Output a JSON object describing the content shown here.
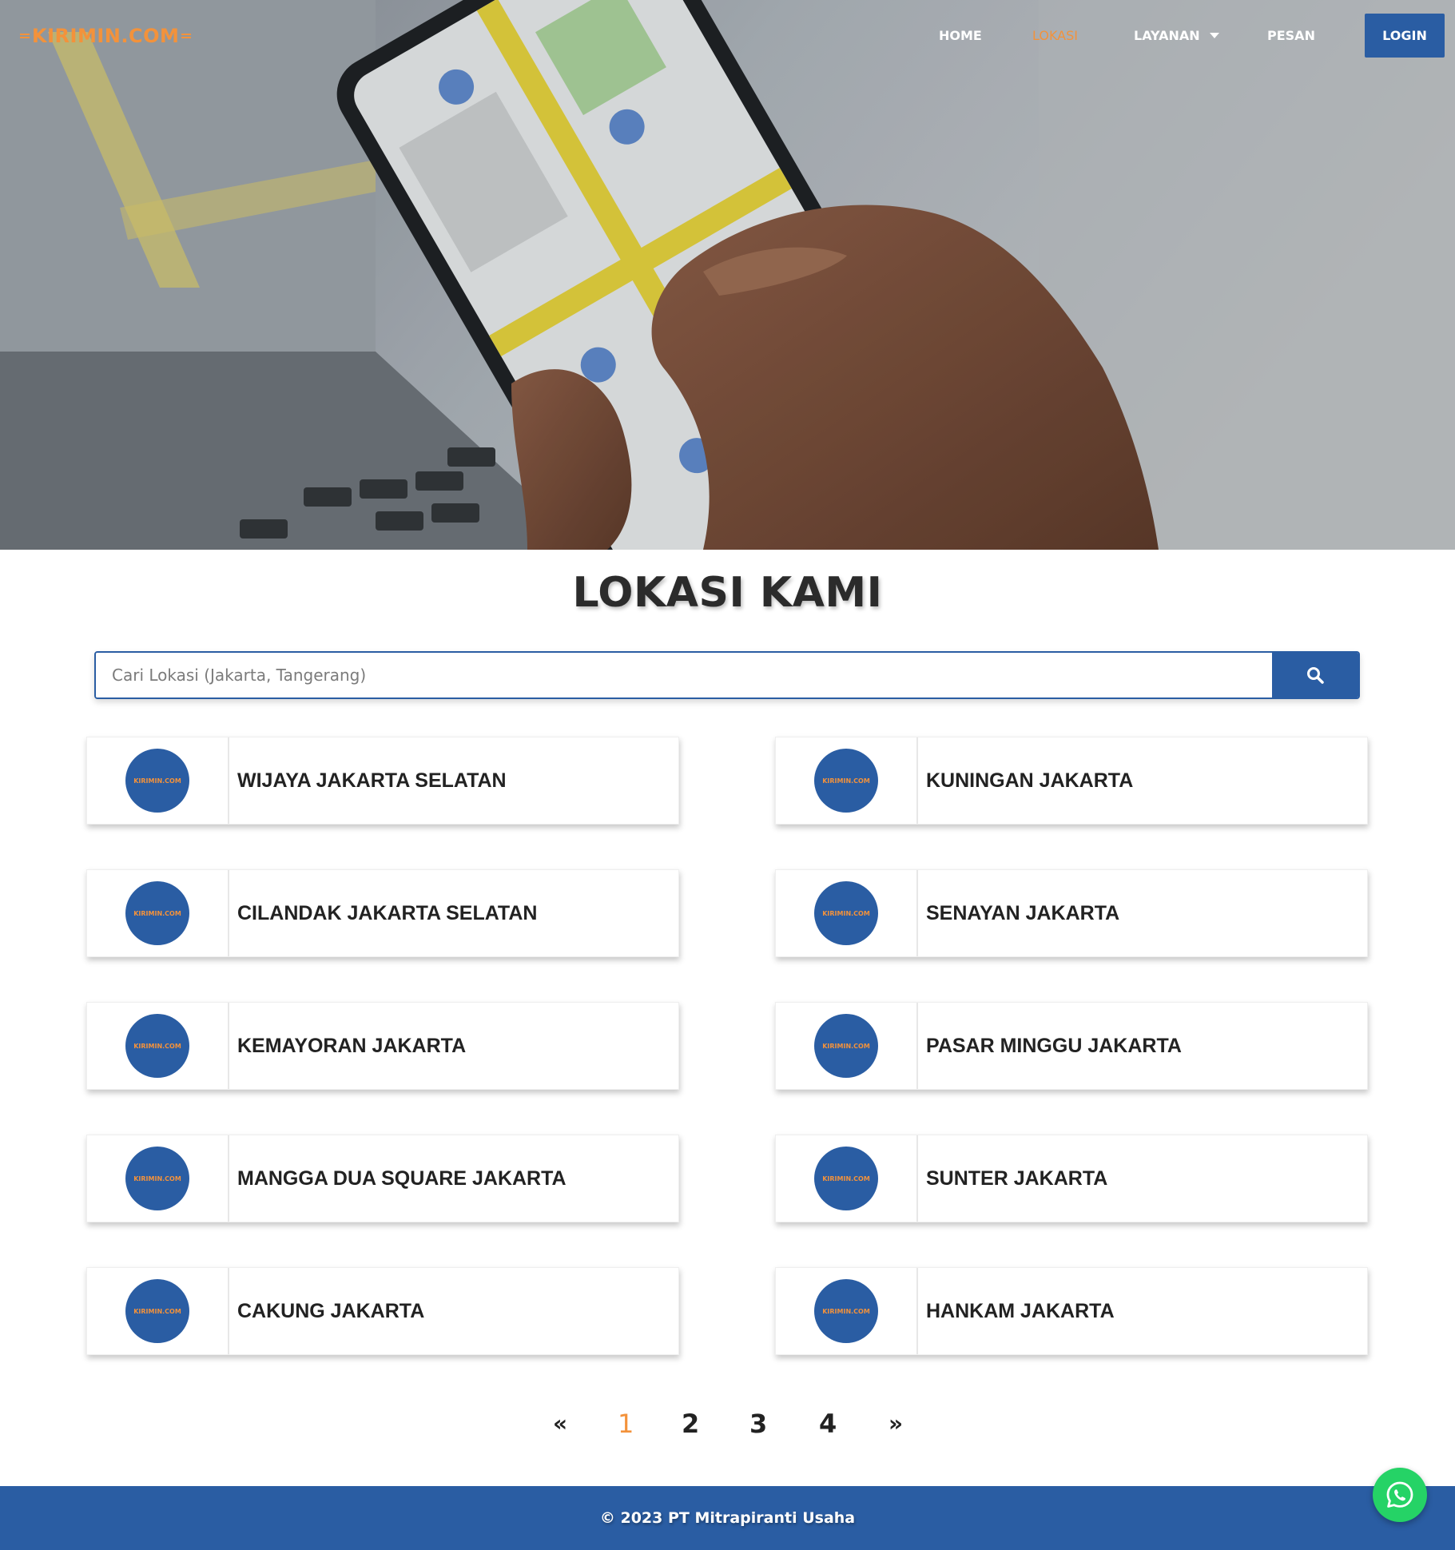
{
  "brand": {
    "logo_text": "KIRIMIN.COM",
    "accent_color": "#f3923b",
    "primary_color": "#2a5da3"
  },
  "nav": {
    "items": [
      {
        "label": "HOME"
      },
      {
        "label": "LOKASI",
        "active": true
      },
      {
        "label": "LAYANAN",
        "has_dropdown": true
      },
      {
        "label": "PESAN"
      }
    ],
    "login_label": "LOGIN"
  },
  "page": {
    "title": "LOKASI KAMI"
  },
  "search": {
    "placeholder": "Cari Lokasi (Jakarta, Tangerang)",
    "value": "",
    "button_icon": "search-icon"
  },
  "locations": [
    {
      "name": "WIJAYA JAKARTA SELATAN",
      "badge": "KIRIMIN.COM"
    },
    {
      "name": "KUNINGAN JAKARTA",
      "badge": "KIRIMIN.COM"
    },
    {
      "name": "CILANDAK JAKARTA SELATAN",
      "badge": "KIRIMIN.COM"
    },
    {
      "name": "SENAYAN JAKARTA",
      "badge": "KIRIMIN.COM"
    },
    {
      "name": "KEMAYORAN JAKARTA",
      "badge": "KIRIMIN.COM"
    },
    {
      "name": "PASAR MINGGU JAKARTA",
      "badge": "KIRIMIN.COM"
    },
    {
      "name": "MANGGA DUA SQUARE JAKARTA",
      "badge": "KIRIMIN.COM"
    },
    {
      "name": "SUNTER JAKARTA",
      "badge": "KIRIMIN.COM"
    },
    {
      "name": "CAKUNG JAKARTA",
      "badge": "KIRIMIN.COM"
    },
    {
      "name": "HANKAM JAKARTA",
      "badge": "KIRIMIN.COM"
    }
  ],
  "pagination": {
    "prev": "«",
    "pages": [
      "1",
      "2",
      "3",
      "4"
    ],
    "current": "1",
    "next": "»"
  },
  "footer": {
    "copyright": "© 2023 PT Mitrapiranti Usaha"
  },
  "floating": {
    "icon": "whatsapp-icon",
    "color": "#25d366"
  }
}
